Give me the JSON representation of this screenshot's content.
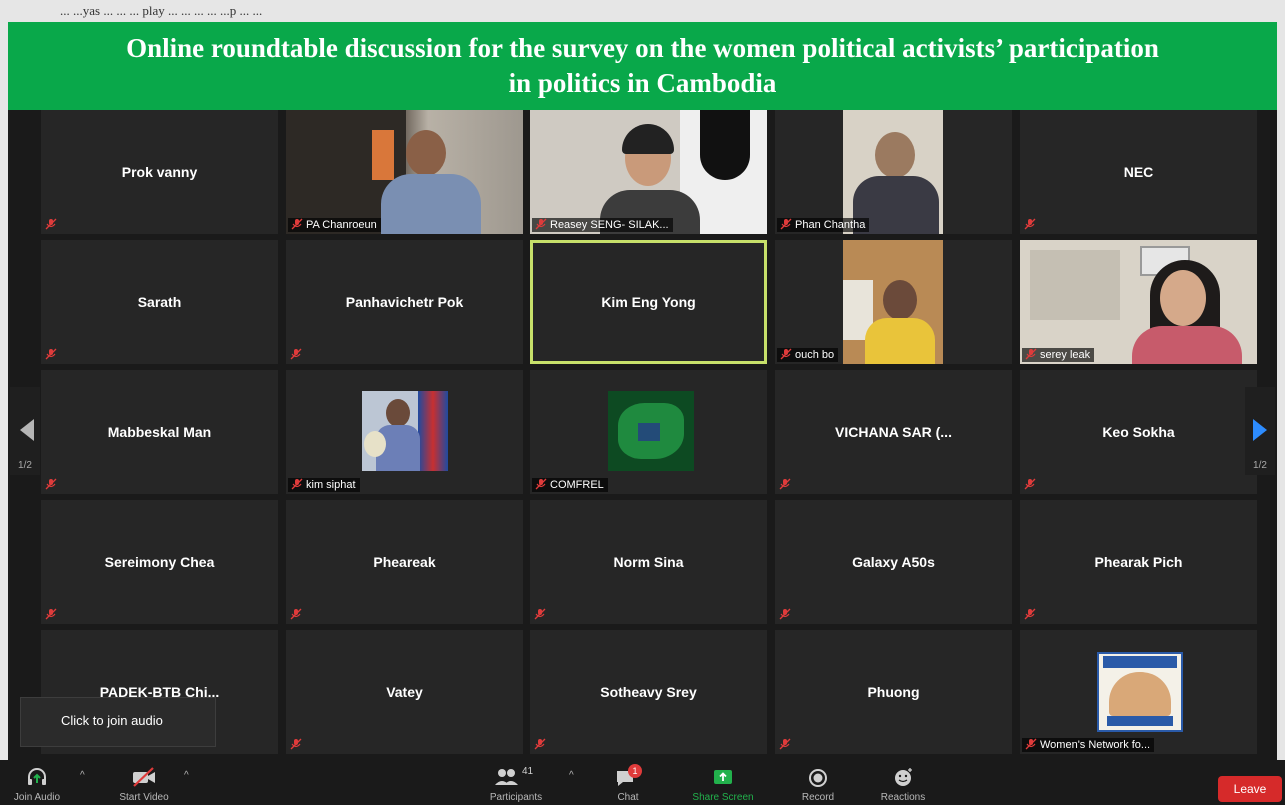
{
  "page_header_fragment": "... ...yas ... ... ... play ... ... ... ... ...p ... ...",
  "banner": {
    "title_line1": "Online roundtable discussion for the survey on the women political activists’ participation",
    "title_line2": "in politics in Cambodia"
  },
  "participants": [
    {
      "name": "Prok vanny"
    },
    {
      "name": "PA Chanroeun"
    },
    {
      "name": "Reasey SENG- SILAK..."
    },
    {
      "name": "Phan Chantha"
    },
    {
      "name": "NEC"
    },
    {
      "name": "Sarath"
    },
    {
      "name": "Panhavichetr Pok"
    },
    {
      "name": "Kim Eng Yong"
    },
    {
      "name": "ouch bo"
    },
    {
      "name": "serey leak"
    },
    {
      "name": "Mabbeskal Man"
    },
    {
      "name": "kim siphat"
    },
    {
      "name": "COMFREL"
    },
    {
      "name": "VICHANA SAR (..."
    },
    {
      "name": "Keo Sokha"
    },
    {
      "name": "Sereimony Chea"
    },
    {
      "name": "Pheareak"
    },
    {
      "name": "Norm Sina"
    },
    {
      "name": "Galaxy A50s"
    },
    {
      "name": "Phearak Pich"
    },
    {
      "name": "PADEK-BTB Chi..."
    },
    {
      "name": "Vatey"
    },
    {
      "name": "Sotheavy Srey"
    },
    {
      "name": "Phuong"
    },
    {
      "name": "Women's Network fo..."
    }
  ],
  "pager": {
    "left_page": "1/2",
    "right_page": "1/2"
  },
  "tooltip": {
    "text": "Click to join audio"
  },
  "toolbar": {
    "join_audio": "Join Audio",
    "start_video": "Start Video",
    "participants": "Participants",
    "participants_count": "41",
    "chat": "Chat",
    "chat_badge": "1",
    "share_screen": "Share Screen",
    "record": "Record",
    "reactions": "Reactions",
    "leave": "Leave"
  },
  "colors": {
    "banner_bg": "#09a84a",
    "active_speaker_border": "#c7e06a",
    "muted_icon": "#e03b3b",
    "share_green": "#22b14c",
    "leave_red": "#d62a2a",
    "next_page_arrow": "#2d8cff"
  }
}
